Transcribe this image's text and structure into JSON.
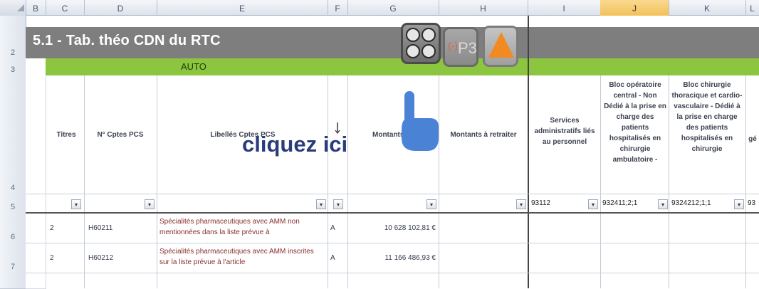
{
  "sheet": {
    "column_headers": [
      "B",
      "C",
      "D",
      "E",
      "F",
      "G",
      "H",
      "I",
      "J",
      "K",
      "L"
    ],
    "selected_column": "J",
    "row_numbers": [
      "2",
      "3",
      "4",
      "5",
      "6",
      "7"
    ],
    "title": "5.1 - Tab. théo CDN du RTC",
    "auto_label": "AUTO",
    "headers": {
      "titres": "Titres",
      "cptes": "N° Cptes PCS",
      "libelles": "Libellés Cptes PCS",
      "montants_tot": "Montants tot",
      "montants_retraiter": "Montants à retraiter",
      "services": "Services administratifs liés au personnel",
      "bloc_op": "Bloc opératoire central - Non Dédié à la prise en charge des patients hospitalisés en chirurgie ambulatoire -",
      "bloc_chir": "Bloc chirurgie thoracique et cardio-vasculaire - Dédié à la prise en charge des patients hospitalisés en chirurgie",
      "gen": "gé"
    },
    "filters": {
      "i": "93112",
      "j": "932411;2;1",
      "k": "9324212;1;1",
      "l": "93"
    },
    "rows": [
      {
        "num": "6",
        "titre": "2",
        "compte": "H60211",
        "libelle": "Spécialités pharmaceutiques avec AMM non mentionnées dans la liste prévue à",
        "flag": "A",
        "montant": "10 628 102,81 €"
      },
      {
        "num": "7",
        "titre": "2",
        "compte": "H60212",
        "libelle": "Spécialités pharmaceutiques avec AMM inscrites sur la liste prévue à l'article",
        "flag": "A",
        "montant": "11 166 486,93 €"
      }
    ]
  },
  "toolbar": {
    "p3_label": "P3",
    "p3_prefix": "(-)"
  },
  "overlay": {
    "cta_text": "cliquez ici",
    "icons": [
      "zoom-buttons-icon",
      "pointing-hand-icon",
      "warning-icon"
    ]
  },
  "colors": {
    "title_bg": "#7e7e7e",
    "auto_bg": "#8cc63e",
    "selected_col": "#f2c15a",
    "cta_text": "#2a3c7a",
    "hand": "#4a82d6"
  }
}
